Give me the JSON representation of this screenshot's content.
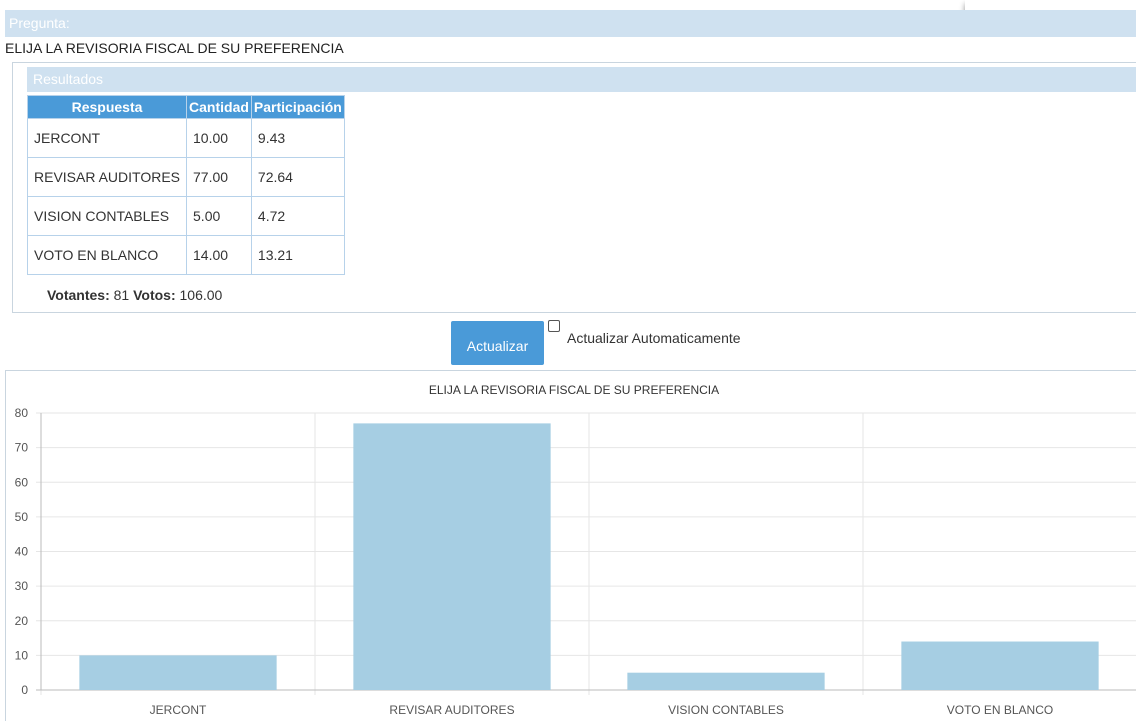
{
  "question": {
    "header": "Pregunta:",
    "text": "ELIJA LA REVISORIA FISCAL DE SU PREFERENCIA"
  },
  "results": {
    "header": "Resultados",
    "columns": [
      "Respuesta",
      "Cantidad",
      "Participación"
    ],
    "rows": [
      [
        "JERCONT",
        "10.00",
        "9.43"
      ],
      [
        "REVISAR AUDITORES",
        "77.00",
        "72.64"
      ],
      [
        "VISION CONTABLES",
        "5.00",
        "4.72"
      ],
      [
        "VOTO EN BLANCO",
        "14.00",
        "13.21"
      ]
    ],
    "summary": {
      "voters_label": "Votantes:",
      "voters_value": "81",
      "votes_label": "Votos:",
      "votes_value": "106.00"
    }
  },
  "controls": {
    "update_button": "Actualizar",
    "auto_update_label": "Actualizar Automaticamente",
    "auto_update_checked": false
  },
  "colors": {
    "header_bg": "#cfe1f0",
    "accent": "#4a9ad8",
    "bar": "#a6cee3"
  },
  "chart_data": {
    "type": "bar",
    "title": "ELIJA LA REVISORIA FISCAL DE SU PREFERENCIA",
    "categories": [
      "JERCONT",
      "REVISAR AUDITORES",
      "VISION CONTABLES",
      "VOTO EN BLANCO"
    ],
    "values": [
      10,
      77,
      5,
      14
    ],
    "ylim": [
      0,
      80
    ],
    "yticks": [
      0,
      10,
      20,
      30,
      40,
      50,
      60,
      70,
      80
    ],
    "grid": true,
    "legend": "none"
  }
}
